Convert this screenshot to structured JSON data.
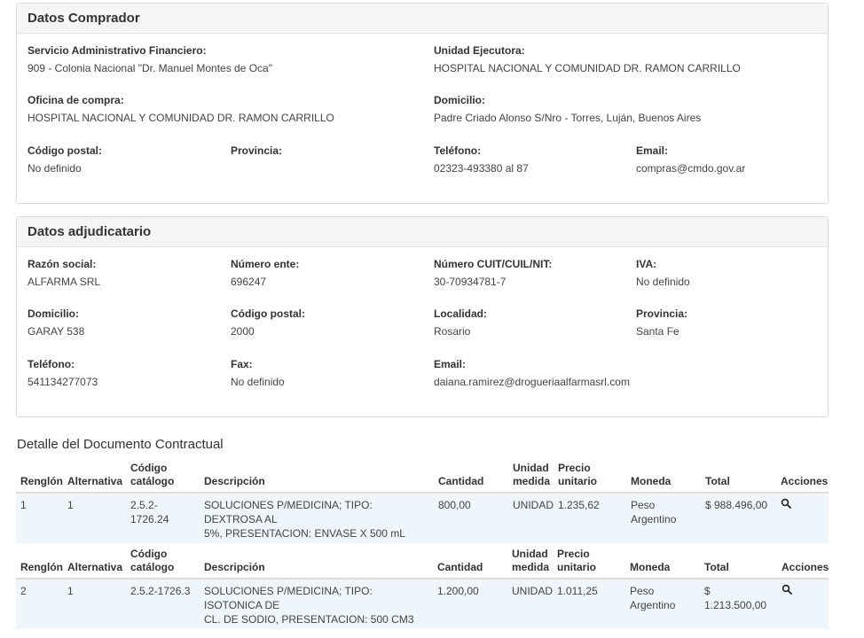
{
  "comprador": {
    "title": "Datos Comprador",
    "saf_label": "Servicio Administrativo Financiero:",
    "saf_value": "909 - Colonia Nacional \"Dr. Manuel Montes de Oca\"",
    "unidad_label": "Unidad Ejecutora:",
    "unidad_value": "HOSPITAL NACIONAL Y COMUNIDAD DR. RAMON CARRILLO",
    "oficina_label": "Oficina de compra:",
    "oficina_value": "HOSPITAL NACIONAL Y COMUNIDAD DR. RAMON CARRILLO",
    "domicilio_label": "Domicilio:",
    "domicilio_value": "Padre Criado Alonso S/Nro - Torres, Luján, Buenos Aires",
    "cp_label": "Código postal:",
    "cp_value": "No definido",
    "provincia_label": "Provincia:",
    "provincia_value": "",
    "telefono_label": "Teléfono:",
    "telefono_value": "02323-493380 al 87",
    "email_label": "Email:",
    "email_value": "compras@cmdo.gov.ar"
  },
  "adjudicatario": {
    "title": "Datos adjudicatario",
    "razon_label": "Razón social:",
    "razon_value": "ALFARMA SRL",
    "ente_label": "Número ente:",
    "ente_value": "696247",
    "cuit_label": "Número CUIT/CUIL/NIT:",
    "cuit_value": "30-70934781-7",
    "iva_label": "IVA:",
    "iva_value": "No definido",
    "domicilio_label": "Domicilio:",
    "domicilio_value": "GARAY 538",
    "cp_label": "Código postal:",
    "cp_value": "2000",
    "localidad_label": "Localidad:",
    "localidad_value": "Rosario",
    "provincia_label": "Provincia:",
    "provincia_value": "Santa Fe",
    "telefono_label": "Teléfono:",
    "telefono_value": "541134277073",
    "fax_label": "Fax:",
    "fax_value": "No definido",
    "email_label": "Email:",
    "email_value": "daiana.ramirez@drogueriaalfarmasrl.com"
  },
  "detalle": {
    "title": "Detalle del Documento Contractual",
    "headers": {
      "renglon": "Renglón",
      "alternativa": "Alternativa",
      "codigo_1": "Código",
      "codigo_2": "catálogo",
      "descripcion": "Descripción",
      "cantidad": "Cantidad",
      "unidad_1": "Unidad",
      "unidad_2": "medida",
      "precio_1": "Precio",
      "precio_2": "unitario",
      "moneda": "Moneda",
      "total": "Total",
      "acciones": "Acciones"
    },
    "rows": [
      {
        "renglon": "1",
        "alternativa": "1",
        "codigo": "2.5.2-1726.24",
        "descripcion_1": "SOLUCIONES P/MEDICINA; TIPO: DEXTROSA AL",
        "descripcion_2": "5%, PRESENTACION: ENVASE X 500 mL",
        "cantidad": "800,00",
        "unidad": "UNIDAD",
        "precio": "1.235,62",
        "moneda_1": "Peso",
        "moneda_2": "Argentino",
        "total": "$ 988.496,00",
        "action_icon": "search-icon"
      },
      {
        "renglon": "2",
        "alternativa": "1",
        "codigo": "2.5.2-1726.3",
        "descripcion_1": "SOLUCIONES P/MEDICINA; TIPO: ISOTONICA DE",
        "descripcion_2": "CL. DE SODIO, PRESENTACION: 500 CM3",
        "cantidad": "1.200,00",
        "unidad": "UNIDAD",
        "precio": "1.011,25",
        "moneda_1": "Peso",
        "moneda_2": "Argentino",
        "total": "$ 1.213.500,00",
        "action_icon": "search-icon"
      }
    ]
  }
}
